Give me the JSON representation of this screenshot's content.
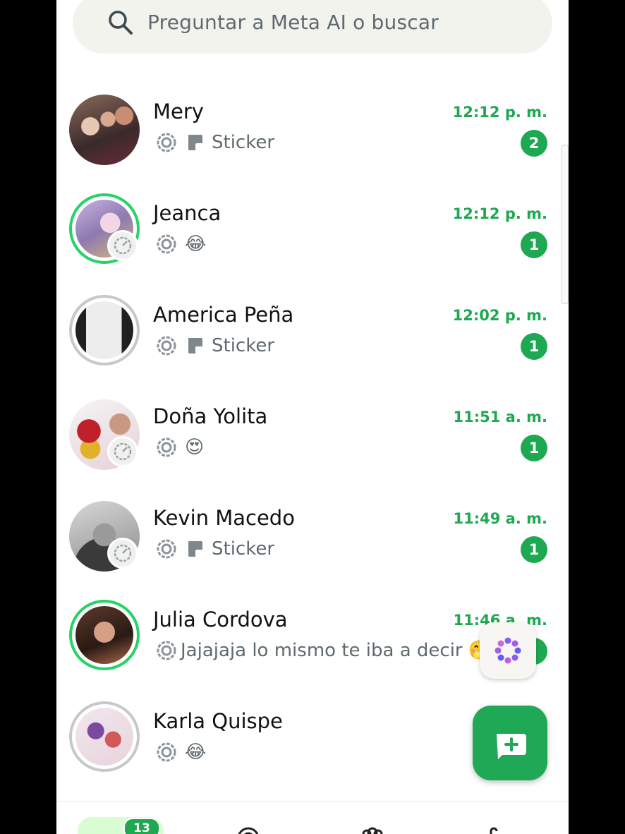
{
  "search": {
    "placeholder": "Preguntar a Meta AI o buscar"
  },
  "chats": [
    {
      "name": "Mery",
      "time": "12:12 p. m.",
      "preview": "Sticker",
      "unread": "2",
      "preview_type": "sticker",
      "ring": "none"
    },
    {
      "name": "Jeanca",
      "time": "12:12 p. m.",
      "preview": "😂",
      "unread": "1",
      "preview_type": "emoji",
      "ring": "green"
    },
    {
      "name": "America Peña",
      "time": "12:02 p. m.",
      "preview": "Sticker",
      "unread": "1",
      "preview_type": "sticker",
      "ring": "gray"
    },
    {
      "name": "Doña Yolita",
      "time": "11:51 a. m.",
      "preview": "😍",
      "unread": "1",
      "preview_type": "emoji",
      "ring": "none"
    },
    {
      "name": "Kevin Macedo",
      "time": "11:49 a. m.",
      "preview": "Sticker",
      "unread": "1",
      "preview_type": "sticker",
      "ring": "none"
    },
    {
      "name": "Julia Cordova",
      "time": "11:46 a. m.",
      "preview": "Jajajaja lo mismo te iba a decir 🤭",
      "unread": "",
      "preview_type": "text",
      "ring": "green"
    },
    {
      "name": "Karla Quispe",
      "time": "",
      "preview": "😂",
      "unread": "",
      "preview_type": "emoji",
      "ring": "gray"
    }
  ],
  "nav": {
    "chats_count": "13"
  },
  "icons": {
    "search": "search-icon",
    "view_once": "view-once-icon",
    "sticker": "sticker-icon",
    "status_timer": "status-timer-icon",
    "meta_ai": "meta-ai-icon",
    "new_chat": "new-chat-icon"
  },
  "colors": {
    "accent": "#1da851",
    "status_ring": "#25d366",
    "nav_active_bg": "#d8fdd2"
  }
}
